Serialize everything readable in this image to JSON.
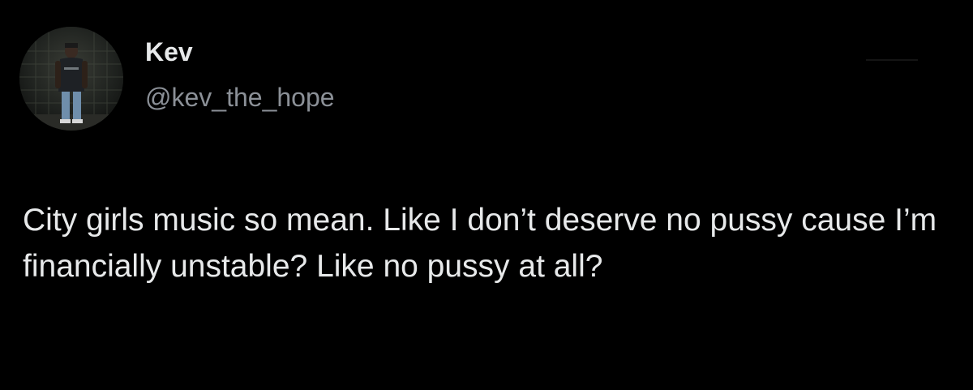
{
  "author": {
    "display_name": "Kev",
    "handle": "@kev_the_hope",
    "avatar_icon": "profile-photo"
  },
  "tweet": {
    "text": "City girls music so mean. Like I don’t deserve no pussy cause I’m financially unstable? Like no pussy at all?"
  },
  "colors": {
    "background": "#000000",
    "primary_text": "#e7e9ea",
    "secondary_text": "#8b9097"
  }
}
